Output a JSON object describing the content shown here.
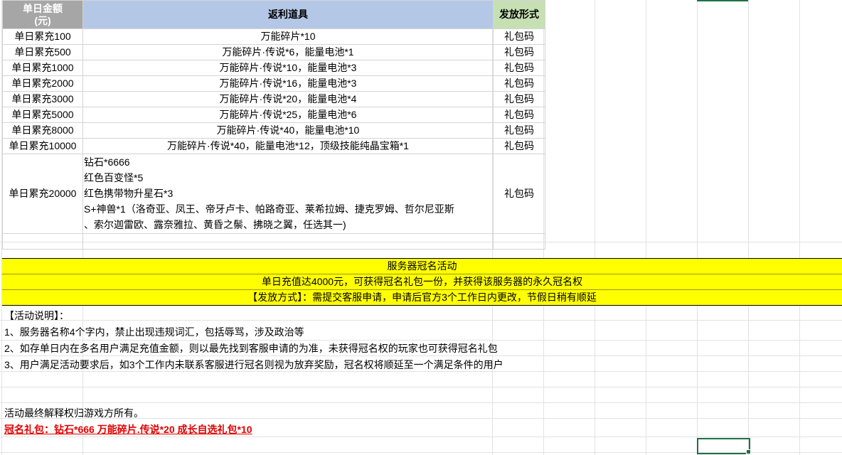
{
  "table": {
    "header": {
      "amount": "单日金额\n(元)",
      "items": "返利道具",
      "method": "发放形式"
    },
    "rows": [
      {
        "amount": "单日累充100",
        "items": "万能碎片*10",
        "method": "礼包码"
      },
      {
        "amount": "单日累充500",
        "items": "万能碎片·传说*6，能量电池*1",
        "method": "礼包码"
      },
      {
        "amount": "单日累充1000",
        "items": "万能碎片·传说*10，能量电池*3",
        "method": "礼包码"
      },
      {
        "amount": "单日累充2000",
        "items": "万能碎片·传说*16，能量电池*3",
        "method": "礼包码"
      },
      {
        "amount": "单日累充3000",
        "items": "万能碎片·传说*20，能量电池*4",
        "method": "礼包码"
      },
      {
        "amount": "单日累充5000",
        "items": "万能碎片·传说*25，能量电池*6",
        "method": "礼包码"
      },
      {
        "amount": "单日累充8000",
        "items": "万能碎片·传说*40，能量电池*10",
        "method": "礼包码"
      },
      {
        "amount": "单日累充10000",
        "items": "万能碎片·传说*40，能量电池*12，顶级技能纯晶宝箱*1",
        "method": "礼包码"
      }
    ],
    "big_row": {
      "amount": "单日累充20000",
      "lines": [
        "钻石*6666",
        "红色百变怪*5",
        "红色携带物升星石*3",
        "S+神兽*1（洛奇亚、凤王、帝牙卢卡、帕路奇亚、莱希拉姆、捷克罗姆、哲尔尼亚斯",
        "、索尔迦雷欧、露奈雅拉、黄昏之鬃、拂晓之翼，任选其一)"
      ],
      "method": "礼包码"
    }
  },
  "naming": {
    "title": "服务器冠名活动",
    "line1": "单日充值达4000元，可获得冠名礼包一份，并获得该服务器的永久冠名权",
    "line2": "【发放方式】：需提交客服申请，申请后官方3个工作日内更改，节假日稍有顺延"
  },
  "notes": {
    "heading": "【活动说明】：",
    "items": [
      "1、服务器名称4个字内，禁止出现违规词汇，包括辱骂，涉及政治等",
      "2、如存单日内在多名用户满足充值金额，则以最先找到客服申请的为准，未获得冠名权的玩家也可获得冠名礼包",
      "3、用户满足活动要求后，如3个工作内未联系客服进行冠名则视为放弃奖励，冠名权将顺延至一个满足条件的用户"
    ],
    "footer": "活动最终解释权归游戏方所有。",
    "gift": "冠名礼包：钻石*666 万能碎片.传说*20 成长自选礼包*10"
  },
  "colors": {
    "header_gray": "#a6a6a6",
    "header_blue": "#b4c7e7",
    "header_green": "#c6e0b4",
    "banner_yellow": "#ffff00",
    "gift_red": "#e00000",
    "selection_green": "#1e7145"
  }
}
